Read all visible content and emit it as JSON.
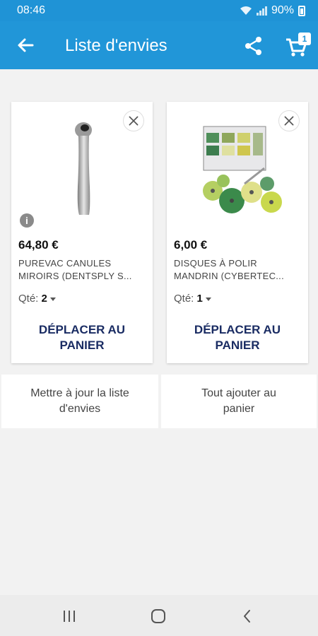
{
  "status": {
    "time": "08:46",
    "battery": "90%"
  },
  "header": {
    "title": "Liste d'envies",
    "cart_count": "1"
  },
  "items": [
    {
      "price": "64,80 €",
      "name_line1": "PUREVAC CANULES",
      "name_line2": "MIROIRS (DENTSPLY S...",
      "qty_label": "Qté:",
      "qty_value": "2",
      "move_line1": "DÉPLACER AU",
      "move_line2": "PANIER",
      "has_info": true
    },
    {
      "price": "6,00 €",
      "name_line1": "DISQUES À POLIR",
      "name_line2": "MANDRIN (CYBERTEC...",
      "qty_label": "Qté:",
      "qty_value": "1",
      "move_line1": "DÉPLACER AU",
      "move_line2": "PANIER",
      "has_info": false
    }
  ],
  "actions": {
    "update_line1": "Mettre à jour la liste",
    "update_line2": "d'envies",
    "add_all_line1": "Tout ajouter au",
    "add_all_line2": "panier"
  },
  "colors": {
    "primary": "#2196d8",
    "button_text": "#1a2c63"
  },
  "icons": [
    "back-arrow-icon",
    "share-icon",
    "cart-icon",
    "close-icon",
    "info-icon",
    "recents-icon",
    "home-icon",
    "nav-back-icon"
  ]
}
